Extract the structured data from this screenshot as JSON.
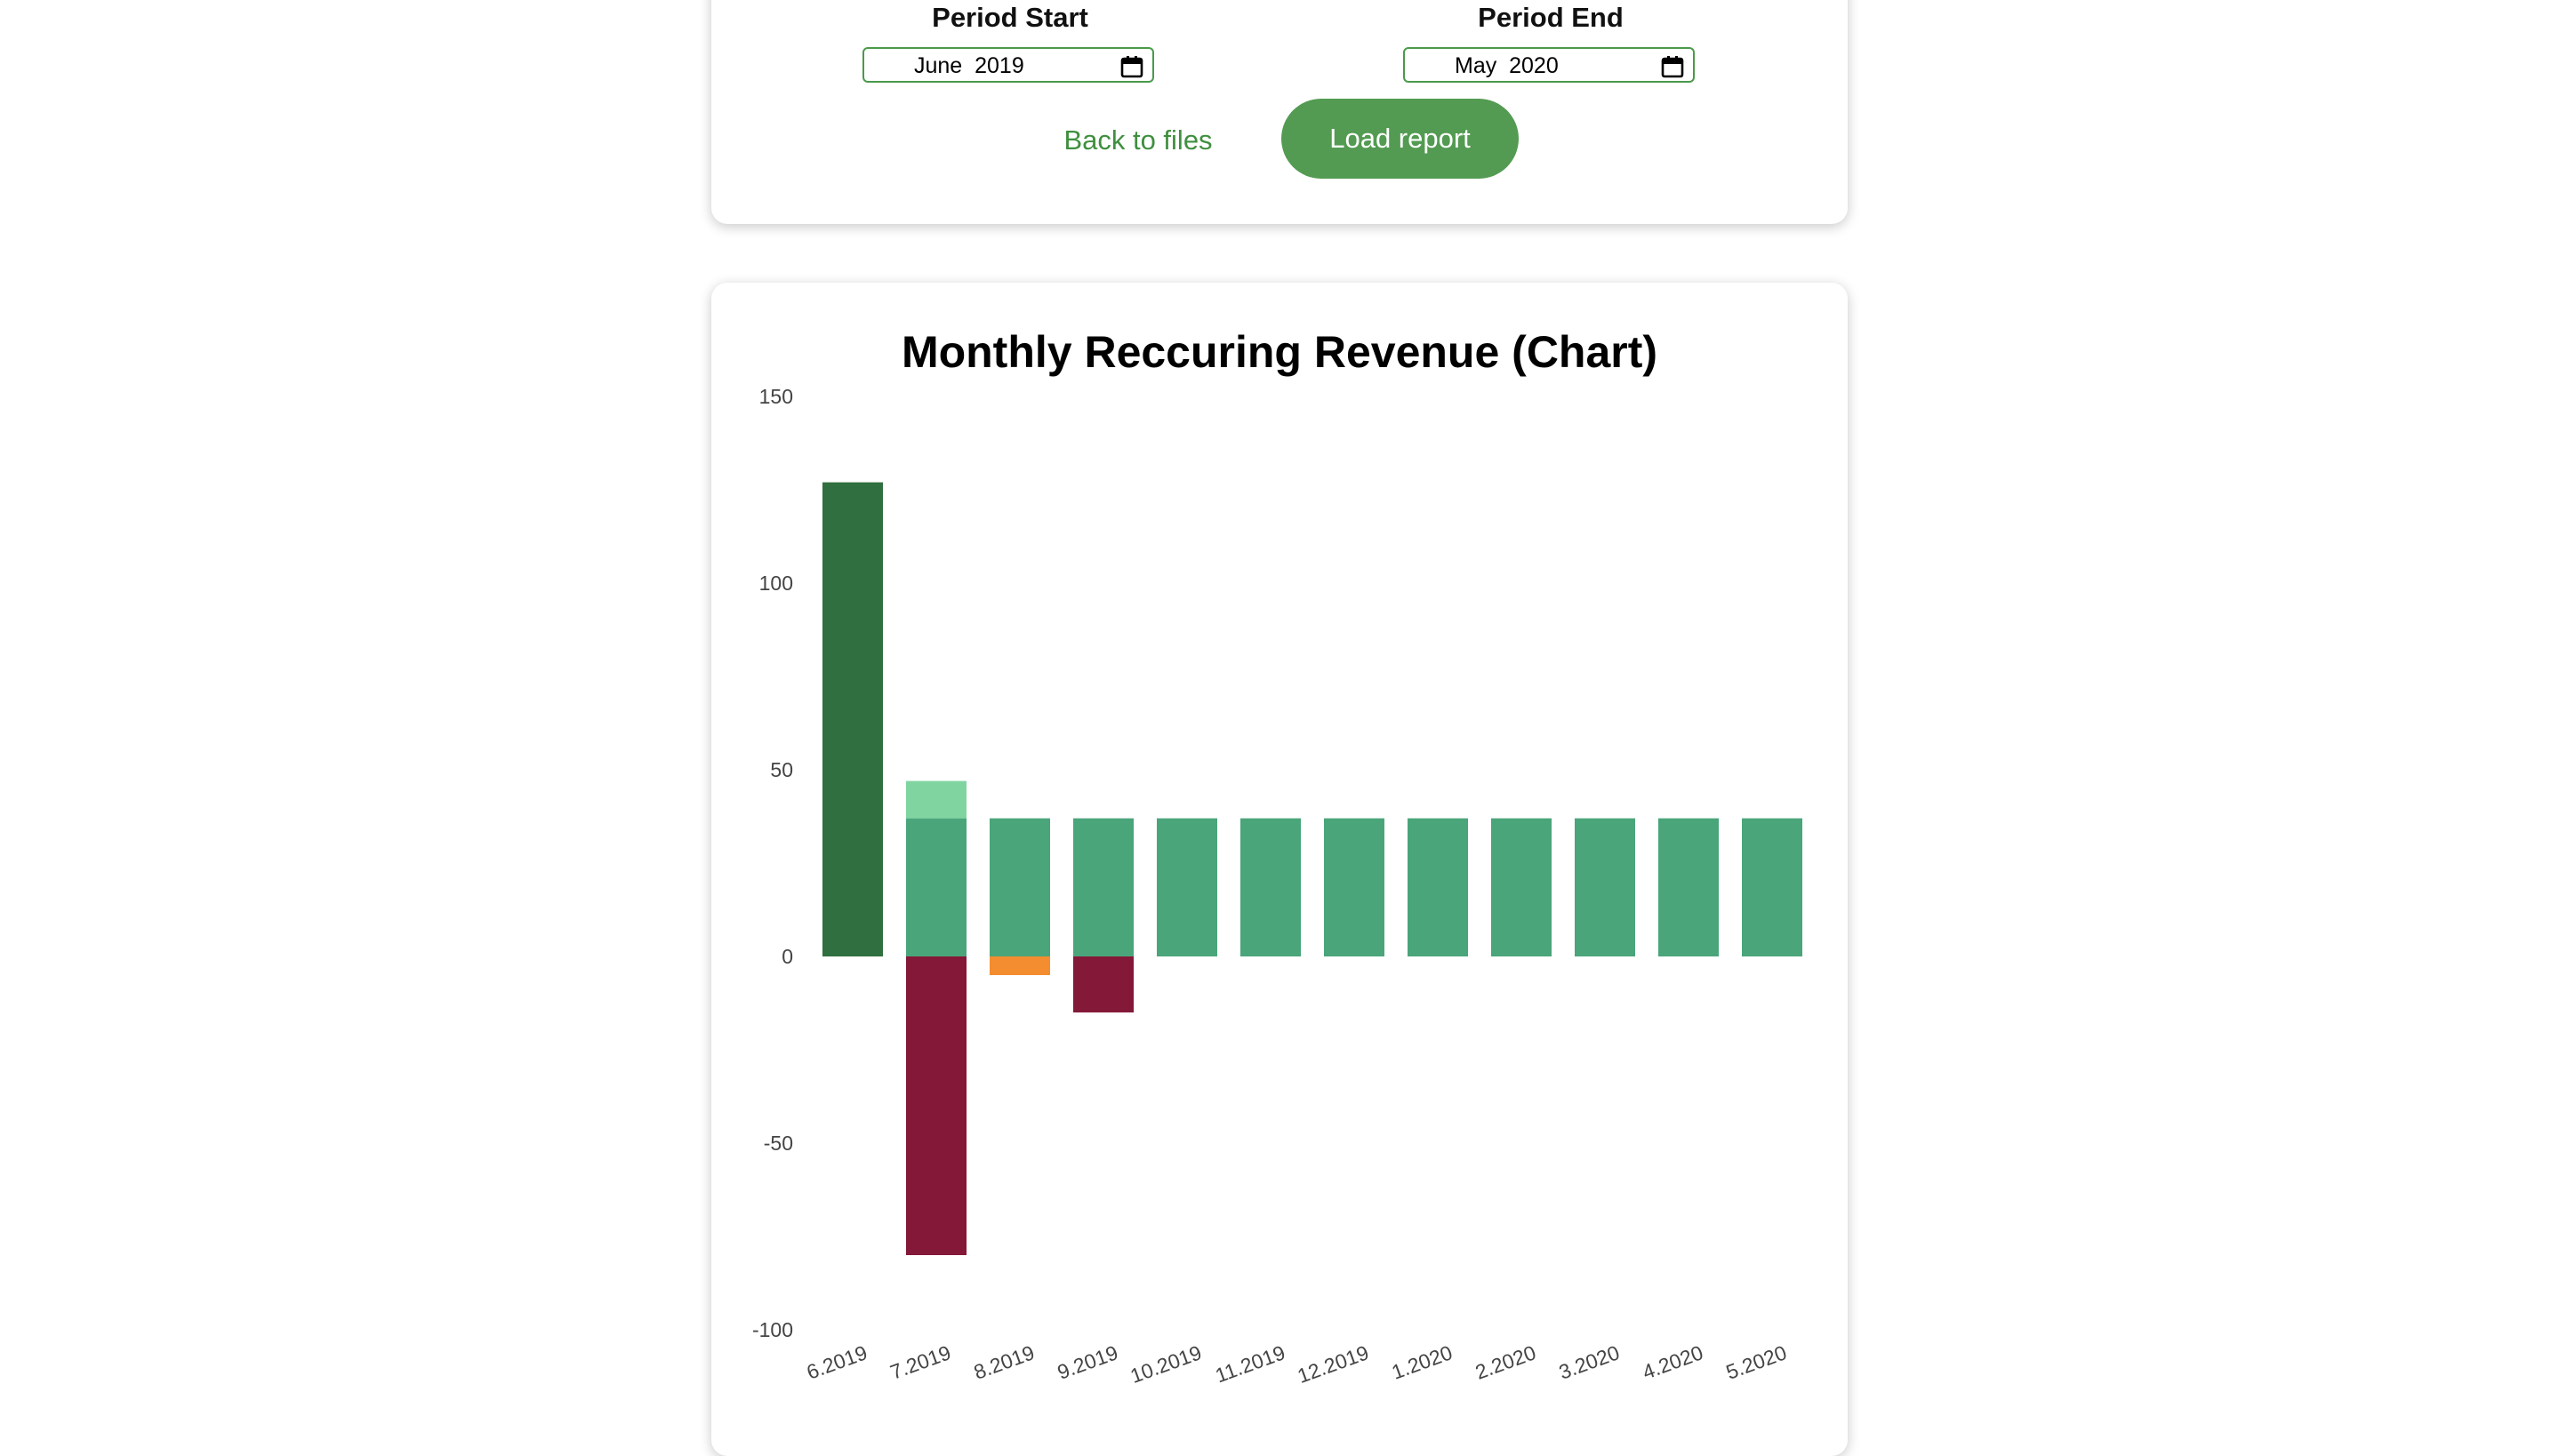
{
  "form": {
    "period_start_label": "Period Start",
    "period_start_value": "June  2019",
    "period_end_label": "Period End",
    "period_end_value": "May  2020",
    "back_label": "Back to files",
    "load_label": "Load report",
    "accent_color": "#539b52",
    "calendar_icon": "calendar-icon"
  },
  "chart_data": {
    "type": "bar",
    "stacked": true,
    "title": "Monthly Reccuring Revenue (Chart)",
    "xlabel": "",
    "ylabel": "",
    "ylim": [
      -100,
      150
    ],
    "yticks": [
      150,
      100,
      50,
      0,
      -50,
      -100
    ],
    "grid": false,
    "legend": "none",
    "categories": [
      "6.2019",
      "7.2019",
      "8.2019",
      "9.2019",
      "10.2019",
      "11.2019",
      "12.2019",
      "1.2020",
      "2.2020",
      "3.2020",
      "4.2020",
      "5.2020"
    ],
    "series": [
      {
        "color": "#306f3f",
        "values": [
          127,
          0,
          0,
          0,
          0,
          0,
          0,
          0,
          0,
          0,
          0,
          0
        ]
      },
      {
        "color": "#4aa57a",
        "values": [
          0,
          37,
          37,
          37,
          37,
          37,
          37,
          37,
          37,
          37,
          37,
          37
        ]
      },
      {
        "color": "#80d4a0",
        "values": [
          0,
          10,
          0,
          0,
          0,
          0,
          0,
          0,
          0,
          0,
          0,
          0
        ]
      },
      {
        "color": "#841838",
        "values": [
          0,
          -80,
          0,
          -15,
          0,
          0,
          0,
          0,
          0,
          0,
          0,
          0
        ]
      },
      {
        "color": "#f48c30",
        "values": [
          0,
          0,
          -5,
          0,
          0,
          0,
          0,
          0,
          0,
          0,
          0,
          0
        ]
      }
    ]
  }
}
